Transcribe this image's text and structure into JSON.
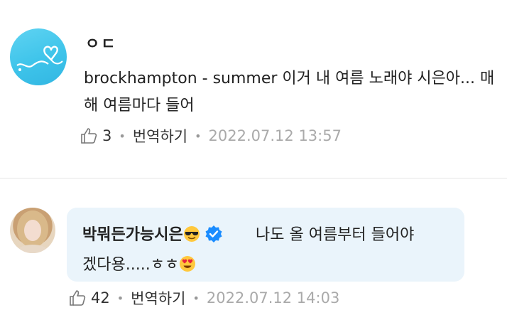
{
  "comments": [
    {
      "username": "ㅇㄷ",
      "text": "brockhampton - summer 이거 내 여름 노래야 시은아... 매해 여름마다 들어",
      "likes": "3",
      "translate_label": "번역하기",
      "timestamp": "2022.07.12 13:57",
      "avatar_color": "#3ec4ea"
    },
    {
      "username": "박뭐든가능시은",
      "text_line1": "나도 올 여름부터 들어야",
      "text_line2": "겠다용.....ㅎㅎ",
      "likes": "42",
      "translate_label": "번역하기",
      "timestamp": "2022.07.12 14:03",
      "bubble_color": "#eaf4fb",
      "verified_color": "#1a8cff"
    }
  ],
  "icons": [
    "thumbs-up-icon",
    "sunglasses-emoji-icon",
    "verified-badge-icon",
    "heart-eyes-emoji-icon"
  ]
}
